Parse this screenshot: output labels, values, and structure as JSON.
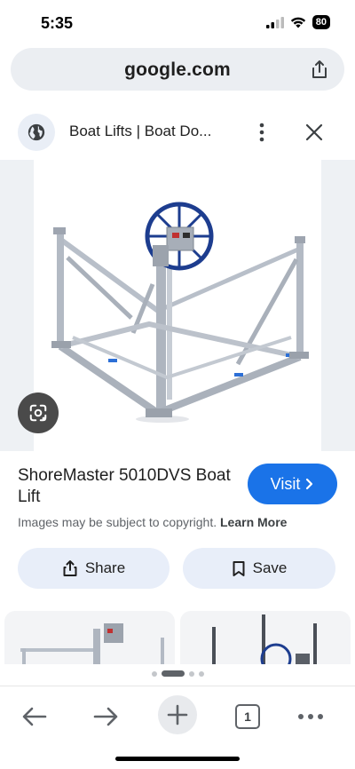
{
  "status_bar": {
    "time": "5:35",
    "battery": "80"
  },
  "url_bar": {
    "domain": "google.com"
  },
  "result": {
    "title": "Boat Lifts | Boat Do...",
    "product_title": "ShoreMaster 5010DVS Boat Lift",
    "visit_label": "Visit",
    "copyright_text": "Images may be subject to copyright.",
    "learn_more": "Learn More",
    "share_label": "Share",
    "save_label": "Save"
  },
  "toolbar": {
    "tab_count": "1"
  },
  "colors": {
    "accent": "#1a73e8",
    "pill_bg": "#e8eef9",
    "url_bg": "#ebeef2",
    "lift_wheel": "#1d3d8f"
  },
  "icons": [
    "signal-icon",
    "wifi-icon",
    "battery-icon",
    "share-icon",
    "globe-icon",
    "more-vert-icon",
    "close-icon",
    "lens-icon",
    "chevron-right-icon",
    "bookmark-icon",
    "back-arrow-icon",
    "forward-arrow-icon",
    "plus-icon",
    "tabs-icon",
    "more-horiz-icon"
  ]
}
